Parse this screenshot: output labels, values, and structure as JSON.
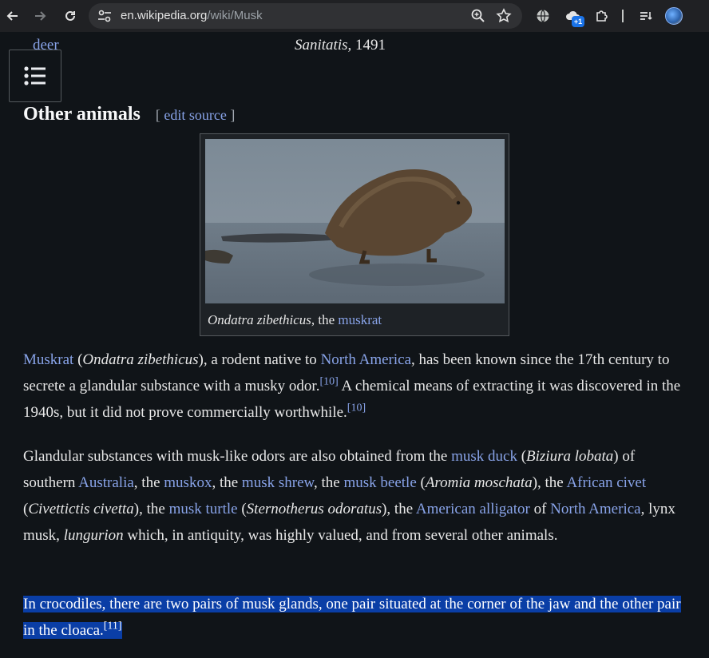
{
  "browser": {
    "url_host": "en.wikipedia.org",
    "url_path": "/wiki/Musk",
    "extension_badge": "+1"
  },
  "page": {
    "prev_link": "deer",
    "prev_caption_italic": "Sanitatis",
    "prev_caption_rest": ", 1491",
    "section_title": "Other animals",
    "edit_open": "[ ",
    "edit_link": "edit source",
    "edit_close": " ]",
    "figure_caption_italic": "Ondatra zibethicus",
    "figure_caption_mid": ", the ",
    "figure_caption_link": "muskrat",
    "p1": {
      "l1": "Muskrat",
      "t1": " (",
      "i1": "Ondatra zibethicus",
      "t2": "), a rodent native to ",
      "l2": "North America",
      "t3": ", has been known since the 17th century to secrete a glandular substance with a musky odor.",
      "r1": "[10]",
      "t4": " A chemical means of extracting it was discovered in the 1940s, but it did not prove commercially worthwhile.",
      "r2": "[10]"
    },
    "p2": {
      "t1": "Glandular substances with musk-like odors are also obtained from the ",
      "l1": "musk duck",
      "t2": " (",
      "i1": "Biziura lobata",
      "t3": ") of southern ",
      "l2": "Australia",
      "t4": ", the ",
      "l3": "muskox",
      "t5": ", the ",
      "l4": "musk shrew",
      "t6": ", the ",
      "l5": "musk beetle",
      "t7": " (",
      "i2": "Aromia moschata",
      "t8": "), the ",
      "l6": "African civet",
      "t9": " (",
      "i3": "Civettictis civetta",
      "t10": "), the ",
      "l7": "musk turtle",
      "t11": " (",
      "i4": "Sternotherus odoratus",
      "t12": "), the ",
      "l8": "American alligator",
      "t13": " of ",
      "l9": "North America",
      "t14": ", lynx musk, ",
      "i5": "lungurion",
      "t15": " which, in antiquity, was highly valued, and from several other animals."
    },
    "p3": {
      "t1": "In crocodiles, there are two pairs of musk glands, one pair situated at the corner of the jaw and the other pair in the cloaca.",
      "r1": "[11]"
    }
  }
}
